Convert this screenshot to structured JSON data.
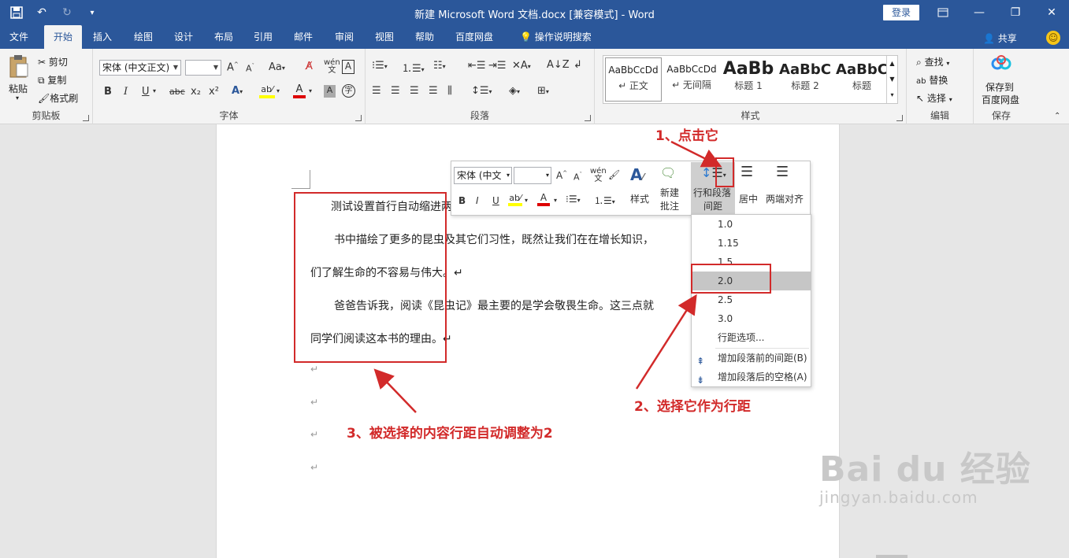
{
  "titlebar": {
    "title": "新建 Microsoft Word 文档.docx [兼容模式] - Word",
    "login": "登录",
    "icons": [
      "save-icon",
      "undo-icon",
      "redo-icon",
      "customize-qat-icon"
    ]
  },
  "tabs": [
    {
      "label": "文件"
    },
    {
      "label": "开始"
    },
    {
      "label": "插入"
    },
    {
      "label": "绘图"
    },
    {
      "label": "设计"
    },
    {
      "label": "布局"
    },
    {
      "label": "引用"
    },
    {
      "label": "邮件"
    },
    {
      "label": "审阅"
    },
    {
      "label": "视图"
    },
    {
      "label": "帮助"
    },
    {
      "label": "百度网盘"
    },
    {
      "label": "操作说明搜索"
    }
  ],
  "share": "共享",
  "clipboard": {
    "paste": "粘贴",
    "cut": "剪切",
    "copy": "复制",
    "format_painter": "格式刷",
    "label": "剪贴板"
  },
  "font": {
    "name": "宋体 (中文正文)",
    "size": "",
    "label": "字体",
    "change_case": "Aa",
    "bold": "B",
    "italic": "I",
    "underline": "U",
    "strike": "abc",
    "subscript": "x₂",
    "superscript": "x²"
  },
  "paragraph": {
    "label": "段落"
  },
  "styles": {
    "label": "样式",
    "items": [
      {
        "preview": "AaBbCcDd",
        "name": "↵ 正文"
      },
      {
        "preview": "AaBbCcDd",
        "name": "↵ 无间隔"
      },
      {
        "preview": "AaBb",
        "name": "标题 1"
      },
      {
        "preview": "AaBbC",
        "name": "标题 2"
      },
      {
        "preview": "AaBbC",
        "name": "标题"
      }
    ]
  },
  "editing": {
    "find": "查找",
    "replace": "替换",
    "select": "选择",
    "label": "编辑"
  },
  "save": {
    "line1": "保存到",
    "line2": "百度网盘",
    "label": "保存"
  },
  "document": {
    "lines": [
      "测试设置首行自动缩进两",
      "书中描绘了更多的昆虫及其它们习性，既然让我们在在增长知识，",
      "们了解生命的不容易与伟大。↵",
      "爸爸告诉我，阅读《昆虫记》最主要的是学会敬畏生命。这三点就",
      "同学们阅读这本书的理由。↵"
    ],
    "empty_mark": "↵"
  },
  "minitoolbar": {
    "font": "宋体 (中文",
    "size": "",
    "styles": "样式",
    "new_comment_1": "新建",
    "new_comment_2": "批注",
    "line_spacing_1": "行和段落",
    "line_spacing_2": "间距",
    "center": "居中",
    "justify": "两端对齐"
  },
  "line_spacing_menu": {
    "options": [
      "1.0",
      "1.15",
      "1.5",
      "2.0",
      "2.5",
      "3.0"
    ],
    "selected": "2.0",
    "more": "行距选项...",
    "add_before": "增加段落前的间距(B)",
    "add_after": "增加段落后的空格(A)"
  },
  "annotations": {
    "step1": "1、点击它",
    "step2": "2、选择它作为行距",
    "step3": "3、被选择的内容行距自动调整为2"
  },
  "watermark": {
    "logo": "Bai du 经验",
    "url": "jingyan.baidu.com"
  },
  "colors": {
    "ribbon_blue": "#2b579a",
    "annotation_red": "#d22a2a",
    "hover_gray": "#c6c6c6"
  }
}
